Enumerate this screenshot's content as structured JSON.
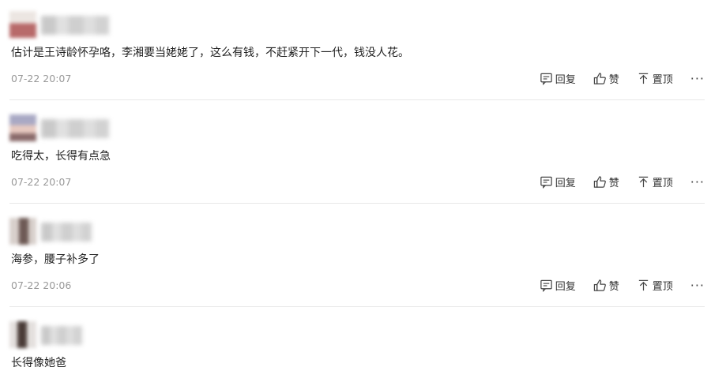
{
  "comments": [
    {
      "text": "估计是王诗龄怀孕咯，李湘要当姥姥了，这么有钱，不赶紧开下一代，钱没人花。",
      "time": "07-22 20:07",
      "actions": {
        "reply": "回复",
        "like": "赞",
        "pin": "置顶",
        "more": "···"
      }
    },
    {
      "text": "吃得太，长得有点急",
      "time": "07-22 20:07",
      "actions": {
        "reply": "回复",
        "like": "赞",
        "pin": "置顶",
        "more": "···"
      }
    },
    {
      "text": "海参，腰子补多了",
      "time": "07-22 20:06",
      "actions": {
        "reply": "回复",
        "like": "赞",
        "pin": "置顶",
        "more": "···"
      }
    },
    {
      "text": "长得像她爸"
    }
  ],
  "colors": {
    "text": "#222222",
    "time": "#999999",
    "divider": "#e8e8e8",
    "action": "#333333"
  },
  "icons": [
    "reply-icon",
    "thumbs-up-icon",
    "pin-to-top-icon",
    "more-icon"
  ]
}
